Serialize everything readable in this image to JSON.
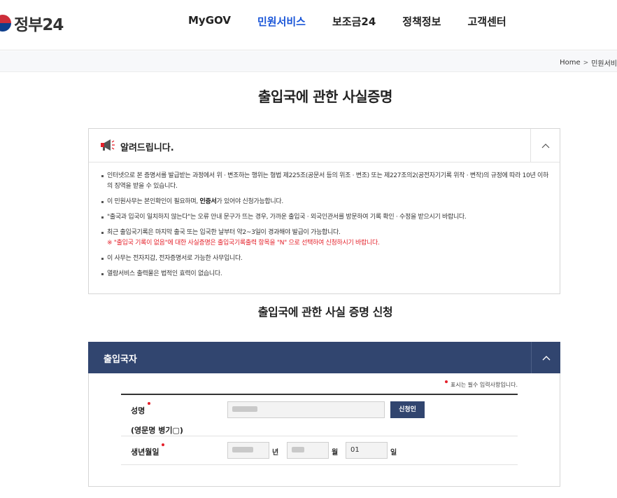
{
  "header": {
    "logo_text": "정부24",
    "nav": [
      {
        "label": "MyGOV"
      },
      {
        "label": "민원서비스"
      },
      {
        "label": "보조금24"
      },
      {
        "label": "정책정보"
      },
      {
        "label": "고객센터"
      }
    ]
  },
  "breadcrumb": {
    "home": "Home",
    "separator": ">",
    "current": "민원서비"
  },
  "page_title": "출입국에 관한 사실증명",
  "notice": {
    "title": "알려드립니다.",
    "items": [
      {
        "text": "인터넷으로 본 증명서를 발급받는 과정에서 위 · 변조하는 행위는 형법 제225조(공문서 등의 위조 · 변조) 또는 제227조의2(공전자기기록 위작 · 변작)의 규정에 따라 10년 이하의 징역을 받을 수 있습니다."
      },
      {
        "text_before": "이 민원사무는 본인확인이 필요하며, ",
        "strong": "인증서",
        "text_after": "가 있어야 신청가능합니다."
      },
      {
        "text": "\"출국과 입국이 일치하지 않는다\"는 오류 안내 문구가 뜨는 경우, 가까운 출입국 · 외국인관서를 방문하여 기록 확인 · 수정을 받으시기 바랍니다."
      },
      {
        "text": "최근 출입국기록은 마지막 출국 또는 입국한 날부터 약2~3일이 경과해야 발급이 가능합니다.",
        "red": "※ \"출입국 기록이 없음\"에 대한 사실증명은 출입국기록출력 항목을 \"N\" 으로 선택하여 신청하시기 바랍니다."
      },
      {
        "text": "이 사무는 전자지갑, 전자증명서로 가능한 사무입니다."
      },
      {
        "text": "열람서비스 출력물은 법적인 효력이 없습니다."
      }
    ]
  },
  "section_title": "출입국에 관한 사실 증명 신청",
  "form": {
    "panel_title": "출입국자",
    "required_note": "표시는 필수 입력사항입니다.",
    "name_label": "성명",
    "english_label": "(영문명 병기▢)",
    "applicant_button": "신청인",
    "birth_label": "생년월일",
    "year_unit": "년",
    "month_unit": "월",
    "day_value": "01",
    "day_unit": "일"
  },
  "colors": {
    "brand_navy": "#31456f",
    "nav_active": "#1a56d8",
    "required_red": "#e4202a"
  },
  "icons": [
    "megaphone-icon",
    "chevron-up-icon",
    "chevron-right-icon"
  ]
}
